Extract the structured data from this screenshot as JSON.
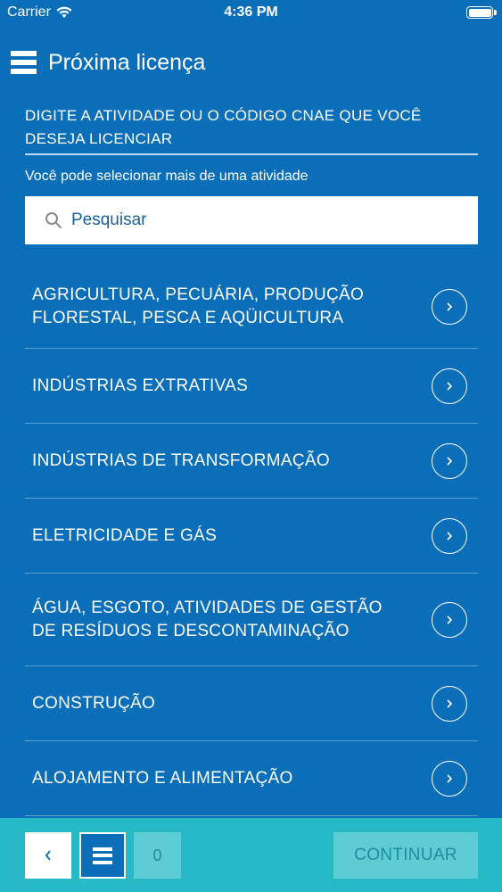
{
  "status_bar": {
    "carrier": "Carrier",
    "time": "4:36 PM"
  },
  "header": {
    "title": "Próxima licença"
  },
  "instruction": "DIGITE A ATIVIDADE OU O CÓDIGO CNAE QUE VOCÊ DESEJA LICENCIAR",
  "subtext": "Você pode selecionar mais de uma atividade",
  "search": {
    "placeholder": "Pesquisar"
  },
  "activities": [
    {
      "label": "AGRICULTURA, PECUÁRIA, PRODUÇÃO FLORESTAL, PESCA E AQÜICULTURA"
    },
    {
      "label": "INDÚSTRIAS EXTRATIVAS"
    },
    {
      "label": "INDÚSTRIAS DE TRANSFORMAÇÃO"
    },
    {
      "label": "ELETRICIDADE E GÁS"
    },
    {
      "label": "ÁGUA, ESGOTO, ATIVIDADES DE GESTÃO DE RESÍDUOS E DESCONTAMINAÇÃO"
    },
    {
      "label": "CONSTRUÇÃO"
    },
    {
      "label": "ALOJAMENTO E ALIMENTAÇÃO"
    }
  ],
  "footer": {
    "selected_count": "0",
    "continue_label": "CONTINUAR"
  },
  "colors": {
    "background": "#0b6eb8",
    "footer": "#27b9c6",
    "disabled_button": "#5ccdd5"
  }
}
